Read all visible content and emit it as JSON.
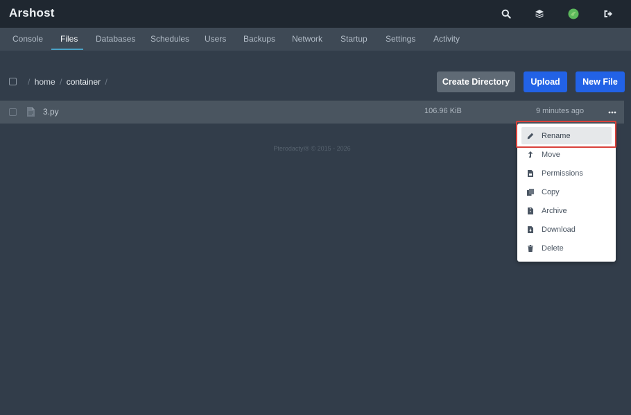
{
  "app": {
    "title": "Arshost"
  },
  "topbar": {
    "icons": [
      "search-icon",
      "layers-icon",
      "avatar",
      "logout-icon"
    ],
    "avatar_color": "#5cb85c"
  },
  "nav": {
    "tabs": [
      "Console",
      "Files",
      "Databases",
      "Schedules",
      "Users",
      "Backups",
      "Network",
      "Startup",
      "Settings",
      "Activity"
    ],
    "active": "Files"
  },
  "breadcrumb": {
    "parts": [
      "home",
      "container"
    ],
    "separator": "/"
  },
  "actions": {
    "create_directory": "Create Directory",
    "upload": "Upload",
    "new_file": "New File"
  },
  "files": [
    {
      "name": "3.py",
      "size": "106.96 KiB",
      "modified": "9 minutes ago"
    }
  ],
  "footer": {
    "text": "Pterodactyl® © 2015 - 2026"
  },
  "context_menu": {
    "items": [
      {
        "label": "Rename",
        "icon": "pencil-icon"
      },
      {
        "label": "Move",
        "icon": "move-arrow-icon"
      },
      {
        "label": "Permissions",
        "icon": "file-lock-icon"
      },
      {
        "label": "Copy",
        "icon": "copy-icon"
      },
      {
        "label": "Archive",
        "icon": "archive-icon"
      },
      {
        "label": "Download",
        "icon": "download-icon"
      },
      {
        "label": "Delete",
        "icon": "trash-icon"
      }
    ],
    "highlighted": "Rename"
  },
  "colors": {
    "background": "#323d4a",
    "topbar": "#1f2730",
    "accent_blue": "#2262e6",
    "highlight_border": "#d9413a"
  }
}
